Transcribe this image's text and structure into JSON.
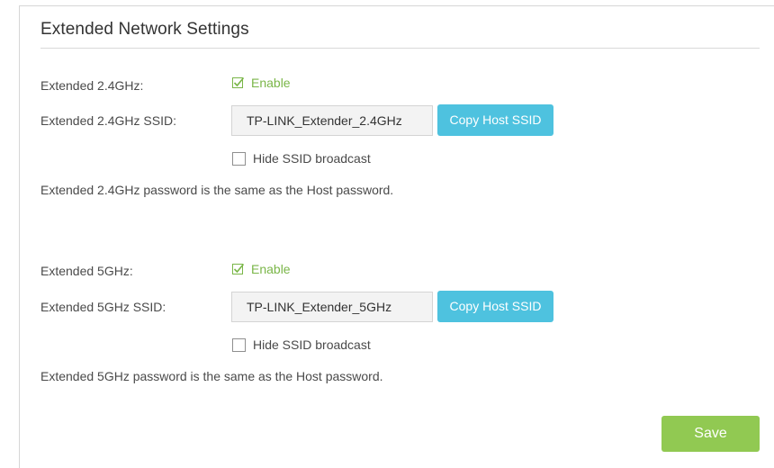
{
  "page": {
    "title": "Extended Network Settings"
  },
  "band_24": {
    "enable_label": "Extended 2.4GHz:",
    "enable_text": "Enable",
    "enabled": true,
    "ssid_label": "Extended 2.4GHz SSID:",
    "ssid_value": "TP-LINK_Extender_2.4GHz",
    "copy_button": "Copy Host SSID",
    "hide_text": "Hide SSID broadcast",
    "hide_checked": false,
    "password_note": "Extended 2.4GHz password is the same as the Host password."
  },
  "band_5": {
    "enable_label": "Extended 5GHz:",
    "enable_text": "Enable",
    "enabled": true,
    "ssid_label": "Extended 5GHz SSID:",
    "ssid_value": "TP-LINK_Extender_5GHz",
    "copy_button": "Copy Host SSID",
    "hide_text": "Hide SSID broadcast",
    "hide_checked": false,
    "password_note": "Extended 5GHz password is the same as the Host password."
  },
  "actions": {
    "save_label": "Save"
  },
  "colors": {
    "accent_green": "#7ab648",
    "copy_button_blue": "#4ec2df",
    "save_button_green": "#91c952"
  },
  "icons": {
    "checked": "checkbox-checked-icon",
    "unchecked": "checkbox-unchecked-icon"
  }
}
